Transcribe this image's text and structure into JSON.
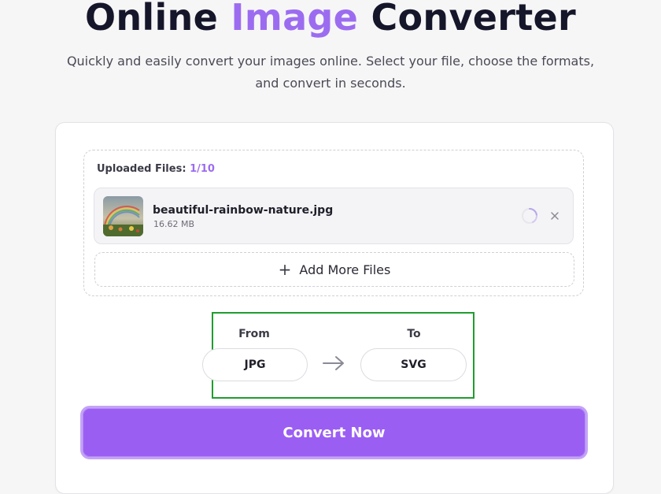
{
  "header": {
    "title_part1": "Online",
    "title_accent": "Image",
    "title_part2": "Converter",
    "subtitle_line1": "Quickly and easily convert your images online. Select your file, choose the formats,",
    "subtitle_line2": "and convert in seconds."
  },
  "uploader": {
    "label": "Uploaded Files:",
    "count": "1/10",
    "files": [
      {
        "name": "beautiful-rainbow-nature.jpg",
        "size": "16.62 MB",
        "status": "loading"
      }
    ],
    "add_more_label": "Add More Files"
  },
  "conversion": {
    "from_label": "From",
    "from_value": "JPG",
    "to_label": "To",
    "to_value": "SVG"
  },
  "actions": {
    "convert_label": "Convert Now"
  },
  "colors": {
    "accent": "#9c6cf0",
    "button": "#9b5ef3",
    "highlight": "#1f9d2f"
  },
  "icons": {
    "spinner": "loading-spinner-icon",
    "remove": "close-icon",
    "add": "plus-icon",
    "arrow": "arrow-right-icon"
  }
}
